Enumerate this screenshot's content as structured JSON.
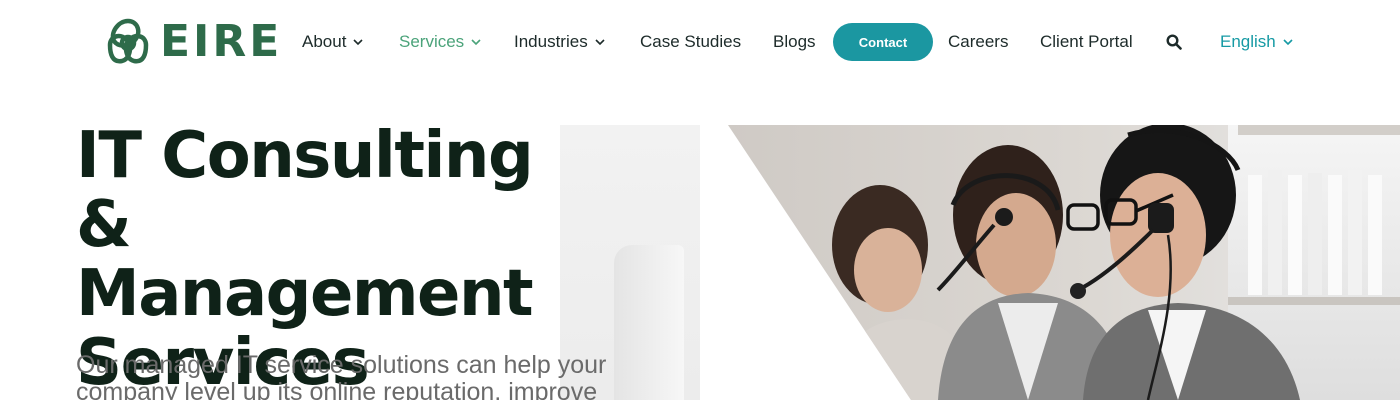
{
  "brand": {
    "name": "EIRE",
    "color": "#2e6b4a"
  },
  "nav": {
    "items": [
      {
        "label": "About",
        "dropdown": true
      },
      {
        "label": "Services",
        "dropdown": true,
        "active": true
      },
      {
        "label": "Industries",
        "dropdown": true
      },
      {
        "label": "Case Studies"
      },
      {
        "label": "Blogs"
      }
    ],
    "contact_label": "Contact",
    "after_contact": [
      {
        "label": "Careers"
      },
      {
        "label": "Client Portal"
      }
    ],
    "search_icon": "search-icon",
    "language": {
      "selected": "English"
    }
  },
  "colors": {
    "accent": "#1b97a1",
    "active_nav": "#4ba37a",
    "heading": "#0f2218"
  },
  "hero": {
    "title_lines": [
      "IT Consulting &",
      "Management",
      "Services"
    ],
    "subtitle_lines": [
      "Our managed IT service solutions can help your",
      "company level up its online reputation, improve"
    ],
    "image": "customer-support-team-with-headsets"
  }
}
